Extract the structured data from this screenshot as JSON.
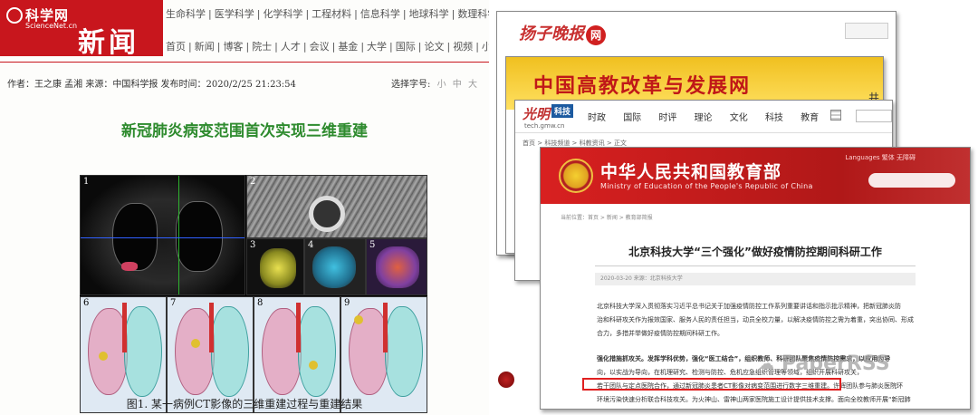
{
  "sciencenet": {
    "logo": {
      "brand": "科学网",
      "domain": "ScienceNet.cn",
      "section": "新闻"
    },
    "nav_top": [
      "生命科学",
      "医学科学",
      "化学科学",
      "工程材料",
      "信息科学",
      "地球科学",
      "数理科学",
      "管"
    ],
    "nav_main": [
      "首页",
      "新闻",
      "博客",
      "院士",
      "人才",
      "会议",
      "基金",
      "大学",
      "国际",
      "论文",
      "视频",
      "小柯机器人"
    ],
    "meta": "作者：王之康  孟湘  来源：中国科学报  发布时间：2020/2/25 21:23:54",
    "font_select": {
      "label": "选择字号:",
      "options": [
        "小",
        "中",
        "大"
      ]
    },
    "title": "新冠肺炎病变范围首次实现三维重建",
    "figure_panels": [
      "1",
      "2",
      "3",
      "4",
      "5",
      "6",
      "7",
      "8",
      "9"
    ],
    "caption": "图1. 某一病例CT影像的三维重建过程与重建结果"
  },
  "yangzi": {
    "logo": "扬子晚报",
    "logo_suffix": "网",
    "stubs": [
      "举",
      "关",
      "机",
      "景",
      "医"
    ]
  },
  "gaojiao": {
    "banner": "中国高教改革与发展网",
    "edge": "井"
  },
  "guangming": {
    "logo": "光明",
    "tag": "科技",
    "url": "tech.gmw.cn",
    "menu": [
      "时政",
      "国际",
      "时评",
      "理论",
      "文化",
      "科技",
      "教育"
    ],
    "breadcrumb": "首页 > 科技频道 > 科教资讯 > 正文"
  },
  "moe": {
    "name": "中华人民共和国教育部",
    "ename": "Ministry of Education of the People's Republic of China",
    "lang": "Languages  繁体  无障碍",
    "breadcrumb": "当前位置：首页 > 新闻 > 教育部简报",
    "title": "北京科技大学“三个强化”做好疫情防控期间科研工作",
    "meta": "2020-03-20    来源：北京科技大学",
    "paragraphs": [
      "北京科技大学深入贯彻落实习近平总书记关于加强疫情防控工作系列重要讲话和指示批示精神，把新冠肺炎防",
      "治和科研攻关作为报效国家、服务人民的责任担当，动员全校力量，以解决疫情防控之需为着重，突出协同、形成",
      "合力，多措并举做好疫情防控期间科研工作。",
      "",
      "强化措施抓攻关。发挥学科优势，强化“医工结合”，组织教师、科研团队聚焦疫情防控需求，以应用为导",
      "向，以实战为导向，在机理研究、检测与防控、危机应急组织管理等领域，组织开展科研攻关，",
      "若干团队与定点医院合作，通过新冠肺炎患者CT影像对病变范围进行数字三维重建。许辉团队参与肺炎医院环",
      "环境污染快速分析联合科技攻关。为火神山、雷神山两家医院施工设计提供技术支撑。面向全校教师开展“新冠肺"
    ],
    "watermark": "PaperRSS"
  }
}
